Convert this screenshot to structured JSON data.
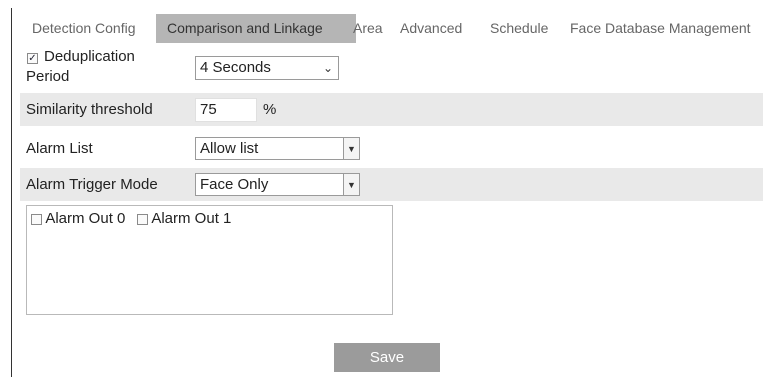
{
  "tabs": [
    {
      "label": "Detection Config",
      "active": false
    },
    {
      "label": "Comparison and Linkage",
      "active": true
    },
    {
      "label": "Area",
      "active": false
    },
    {
      "label": "Advanced",
      "active": false
    },
    {
      "label": "Schedule",
      "active": false
    },
    {
      "label": "Face Database Management",
      "active": false
    }
  ],
  "form": {
    "dedup": {
      "checked": true,
      "label_line1": "Deduplication",
      "label_line2": "Period",
      "value": "4 Seconds"
    },
    "similarity": {
      "label": "Similarity threshold",
      "value": "75",
      "unit": "%"
    },
    "alarm_list": {
      "label": "Alarm List",
      "value": "Allow list"
    },
    "alarm_trigger": {
      "label": "Alarm Trigger Mode",
      "value": "Face Only"
    }
  },
  "alarm_outputs": [
    {
      "label": "Alarm Out 0",
      "checked": false
    },
    {
      "label": "Alarm Out 1",
      "checked": false
    }
  ],
  "save_label": "Save",
  "icons": {
    "check": "✓",
    "chevron": "⌄",
    "dropdown": "▼"
  },
  "colors": {
    "active_tab": "#b5b5b5",
    "row_shade": "#e9e9e9",
    "button": "#9b9b9b"
  }
}
